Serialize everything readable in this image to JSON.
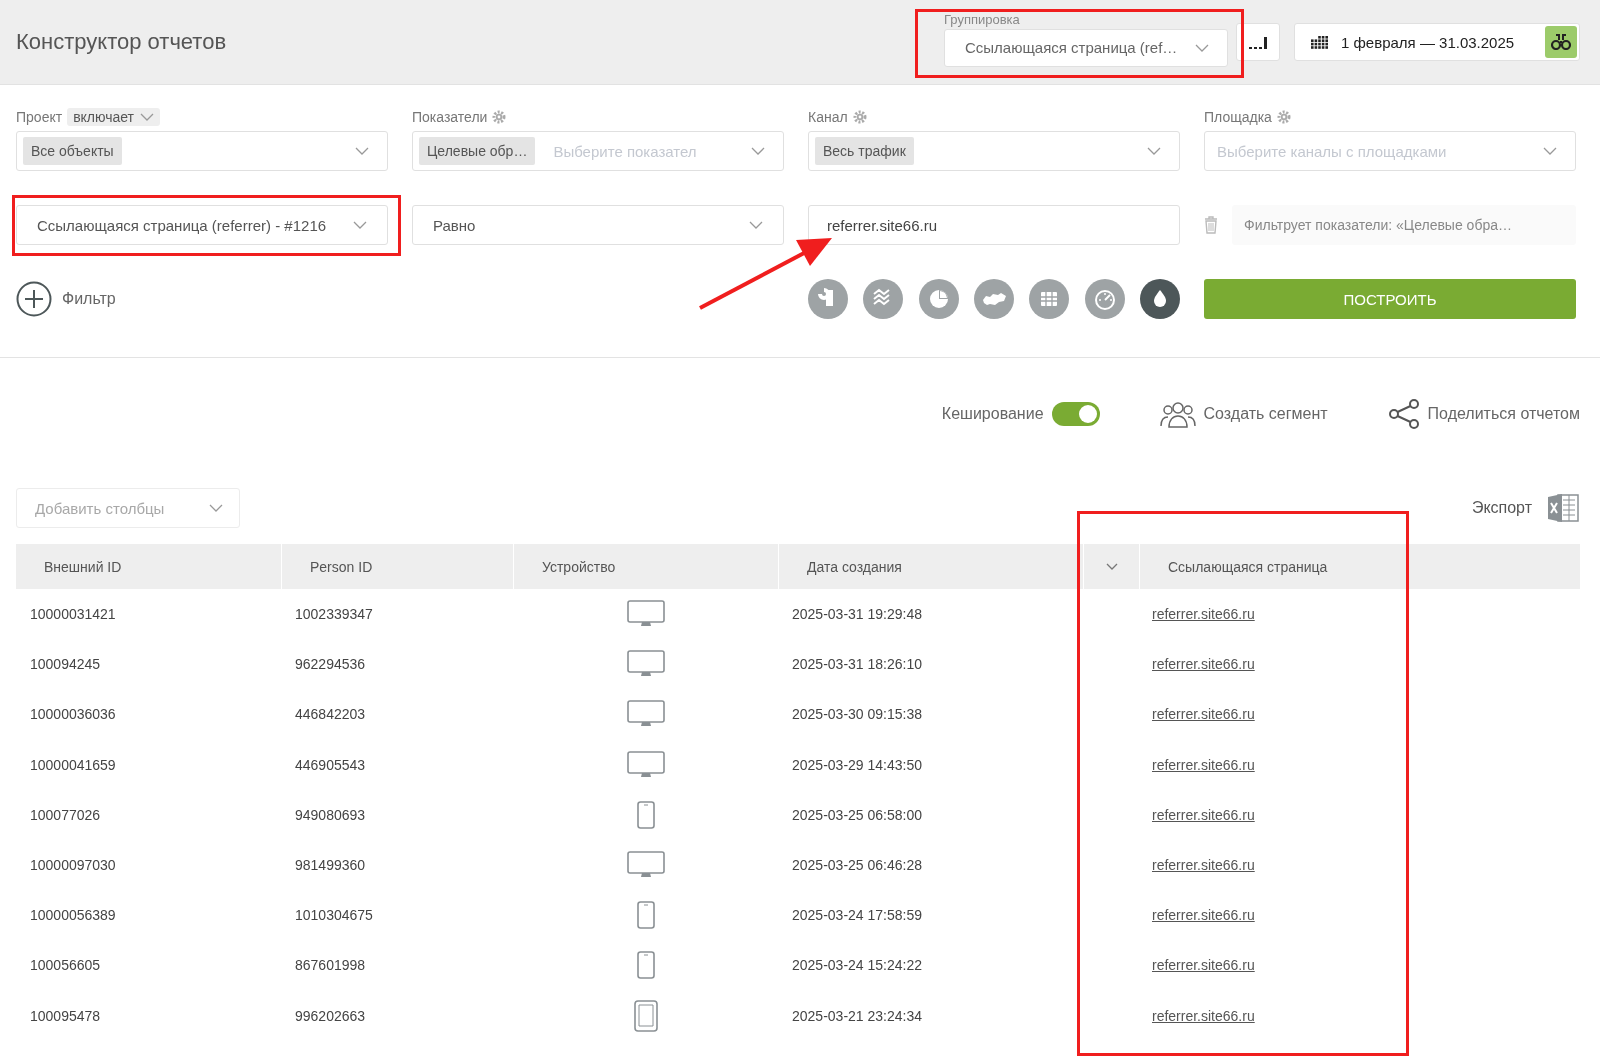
{
  "header": {
    "title": "Конструктор отчетов",
    "grouping": {
      "label": "Группировка",
      "value": "Ссылающаяся страница (ref…"
    },
    "date_range": "1 февраля — 31.03.2025"
  },
  "filters": [
    {
      "label": "Проект",
      "kind": "mode",
      "mode": "включает",
      "tag": "Все объекты"
    },
    {
      "label": "Показатели",
      "kind": "gear",
      "tag": "Целевые обр…",
      "placeholder": "Выберите показател"
    },
    {
      "label": "Канал",
      "kind": "gear",
      "tag": "Весь трафик"
    },
    {
      "label": "Площадка",
      "kind": "gear",
      "placeholder": "Выберите каналы с площадками"
    }
  ],
  "condition": {
    "field": "Ссылающаяся страница (referrer) - #1216",
    "operator": "Равно",
    "value": "referrer.site66.ru",
    "note": "Фильтрует показатели: «Целевые обра…"
  },
  "add_filter": "Фильтр",
  "chart_types": [
    {
      "kind": "cohort",
      "selected": false
    },
    {
      "kind": "stream",
      "selected": false
    },
    {
      "kind": "pie",
      "selected": false
    },
    {
      "kind": "map",
      "selected": false
    },
    {
      "kind": "table",
      "selected": false
    },
    {
      "kind": "gauge",
      "selected": false
    },
    {
      "kind": "drop",
      "selected": true
    }
  ],
  "build_button": "ПОСТРОИТЬ",
  "options": {
    "caching": {
      "label": "Кеширование",
      "on": true
    },
    "segment": "Создать сегмент",
    "share": "Поделиться отчетом"
  },
  "add_columns": {
    "placeholder": "Добавить столбцы"
  },
  "export": "Экспорт",
  "table": {
    "columns": [
      "Внешний ID",
      "Person ID",
      "Устройство",
      "Дата создания",
      "Ссылающаяся страница"
    ],
    "rows": [
      {
        "external_id": "10000031421",
        "person_id": "1002339347",
        "kind": "desktop",
        "created": "2025-03-31 19:29:48",
        "referrer": "referrer.site66.ru"
      },
      {
        "external_id": "100094245",
        "person_id": "962294536",
        "kind": "desktop",
        "created": "2025-03-31 18:26:10",
        "referrer": "referrer.site66.ru"
      },
      {
        "external_id": "10000036036",
        "person_id": "446842203",
        "kind": "desktop",
        "created": "2025-03-30 09:15:38",
        "referrer": "referrer.site66.ru"
      },
      {
        "external_id": "10000041659",
        "person_id": "446905543",
        "kind": "desktop",
        "created": "2025-03-29 14:43:50",
        "referrer": "referrer.site66.ru"
      },
      {
        "external_id": "100077026",
        "person_id": "949080693",
        "kind": "phone",
        "created": "2025-03-25 06:58:00",
        "referrer": "referrer.site66.ru"
      },
      {
        "external_id": "10000097030",
        "person_id": "981499360",
        "kind": "desktop",
        "created": "2025-03-25 06:46:28",
        "referrer": "referrer.site66.ru"
      },
      {
        "external_id": "10000056389",
        "person_id": "1010304675",
        "kind": "phone",
        "created": "2025-03-24 17:58:59",
        "referrer": "referrer.site66.ru"
      },
      {
        "external_id": "100056605",
        "person_id": "867601998",
        "kind": "phone",
        "created": "2025-03-24 15:24:22",
        "referrer": "referrer.site66.ru"
      },
      {
        "external_id": "100095478",
        "person_id": "996202663",
        "kind": "tablet",
        "created": "2025-03-21 23:24:34",
        "referrer": "referrer.site66.ru"
      }
    ]
  }
}
